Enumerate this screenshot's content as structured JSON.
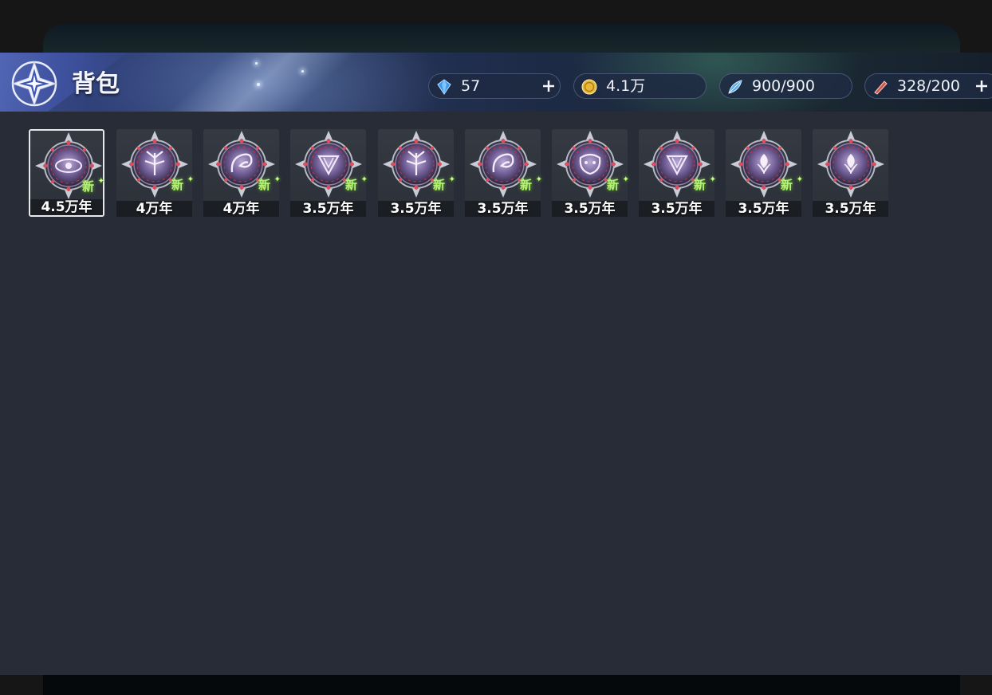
{
  "header": {
    "title": "背包",
    "logo_icon": "four-point-star-emblem-icon"
  },
  "resources": [
    {
      "name": "diamond",
      "icon": "blue-diamond-icon",
      "value": "57",
      "has_plus": true
    },
    {
      "name": "gold",
      "icon": "gold-coin-icon",
      "value": "4.1万",
      "has_plus": false
    },
    {
      "name": "stamina",
      "icon": "blue-feather-icon",
      "value": "900/900",
      "has_plus": false
    },
    {
      "name": "item",
      "icon": "red-stick-icon",
      "value": "328/200",
      "has_plus": true
    }
  ],
  "items": [
    {
      "age": "4.5万年",
      "new_label": "新",
      "is_new": true,
      "emblem": "eye",
      "selected": true
    },
    {
      "age": "4万年",
      "new_label": "新",
      "is_new": true,
      "emblem": "stag",
      "selected": false
    },
    {
      "age": "4万年",
      "new_label": "新",
      "is_new": true,
      "emblem": "dragon",
      "selected": false
    },
    {
      "age": "3.5万年",
      "new_label": "新",
      "is_new": true,
      "emblem": "crest",
      "selected": false
    },
    {
      "age": "3.5万年",
      "new_label": "新",
      "is_new": true,
      "emblem": "stag",
      "selected": false
    },
    {
      "age": "3.5万年",
      "new_label": "新",
      "is_new": true,
      "emblem": "dragon",
      "selected": false
    },
    {
      "age": "3.5万年",
      "new_label": "新",
      "is_new": true,
      "emblem": "beast",
      "selected": false
    },
    {
      "age": "3.5万年",
      "new_label": "新",
      "is_new": true,
      "emblem": "crest",
      "selected": false
    },
    {
      "age": "3.5万年",
      "new_label": "新",
      "is_new": true,
      "emblem": "flower",
      "selected": false
    },
    {
      "age": "3.5万年",
      "new_label": "",
      "is_new": false,
      "emblem": "flower",
      "selected": false
    }
  ],
  "colors": {
    "panel": "#282c37",
    "new_tag": "#b8f07a"
  }
}
